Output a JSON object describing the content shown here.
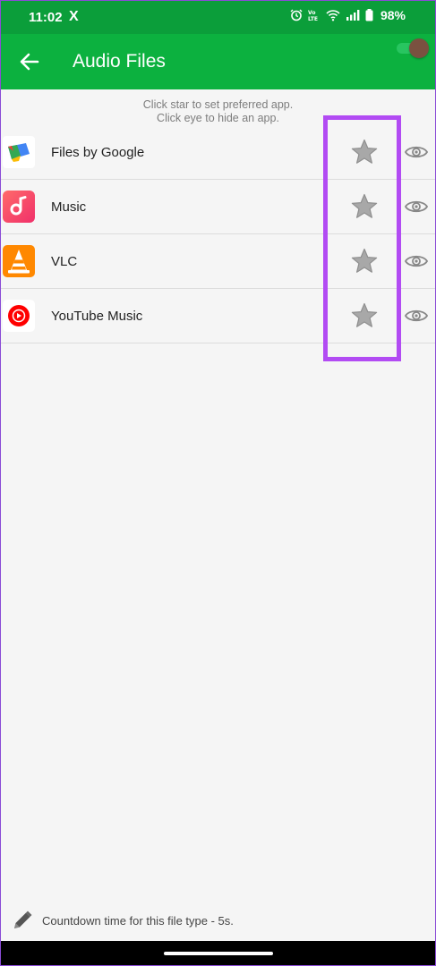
{
  "status_bar": {
    "time": "11:02",
    "x_app": "X",
    "battery": "98%"
  },
  "app_bar": {
    "title": "Audio Files"
  },
  "hint": {
    "line1": "Click star to set preferred app.",
    "line2": "Click eye to hide an app."
  },
  "apps": [
    {
      "name": "Files by Google",
      "icon": "files-by-google-icon"
    },
    {
      "name": "Music",
      "icon": "music-icon"
    },
    {
      "name": "VLC",
      "icon": "vlc-icon"
    },
    {
      "name": "YouTube Music",
      "icon": "youtube-music-icon"
    }
  ],
  "footer": {
    "text": "Countdown time for this file type - 5s."
  },
  "colors": {
    "status_bar": "#0b9e3a",
    "app_bar": "#0cb13f",
    "highlight": "#b24bf3",
    "star": "#a8a8a8"
  }
}
